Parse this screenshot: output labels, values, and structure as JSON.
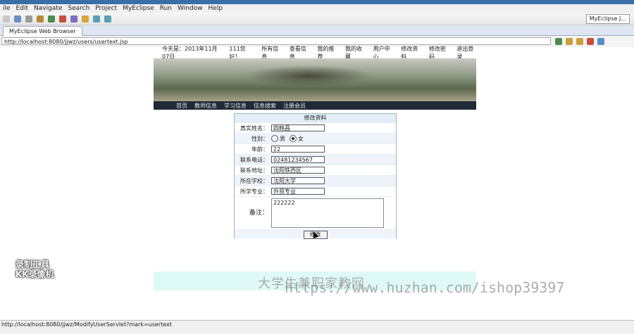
{
  "window": {
    "menu": [
      "ile",
      "Edit",
      "Navigate",
      "Search",
      "Project",
      "MyEclipse",
      "Run",
      "Window",
      "Help"
    ],
    "perspective": "MyEclipse J..."
  },
  "browser": {
    "tab_label": "MyEclipse Web Browser",
    "url": "http://localhost:8080/jjwz/users/usertext.jsp"
  },
  "site": {
    "topline": [
      "今天是：2013年11月07日",
      "111您好！",
      "所有信息",
      "查看信息",
      "我的推荐",
      "我的收藏",
      "用户中心",
      "修改资料",
      "修改密码",
      "退出登录"
    ],
    "nav": [
      "首页",
      "教师信息",
      "学习信息",
      "信息搜索",
      "注册会员"
    ]
  },
  "form": {
    "title": "修改资料",
    "rows": [
      {
        "label": "真实姓名：",
        "value": "四韩昌"
      },
      {
        "label": "性别：",
        "radio_1": "男",
        "radio_2": "女"
      },
      {
        "label": "年龄：",
        "value": "22"
      },
      {
        "label": "联系电话：",
        "value": "02481234567"
      },
      {
        "label": "联系地址：",
        "value": "沈阳铁西区"
      },
      {
        "label": "所在学校：",
        "value": "沈阳大学"
      },
      {
        "label": "所学专业：",
        "value": "外贸专业"
      }
    ],
    "remark_label": "备注：",
    "remark_value": "222222",
    "submit": "修改"
  },
  "watermark": {
    "cn": "大学生兼职家教网",
    "url": "https://www.huzhan.com/ishop39397"
  },
  "recorder_badge": {
    "line1": "录制工具",
    "line2": "KK录像机"
  },
  "status": "http://localhost:8080/jjwz/ModifyUserServlet?mark=usertext"
}
